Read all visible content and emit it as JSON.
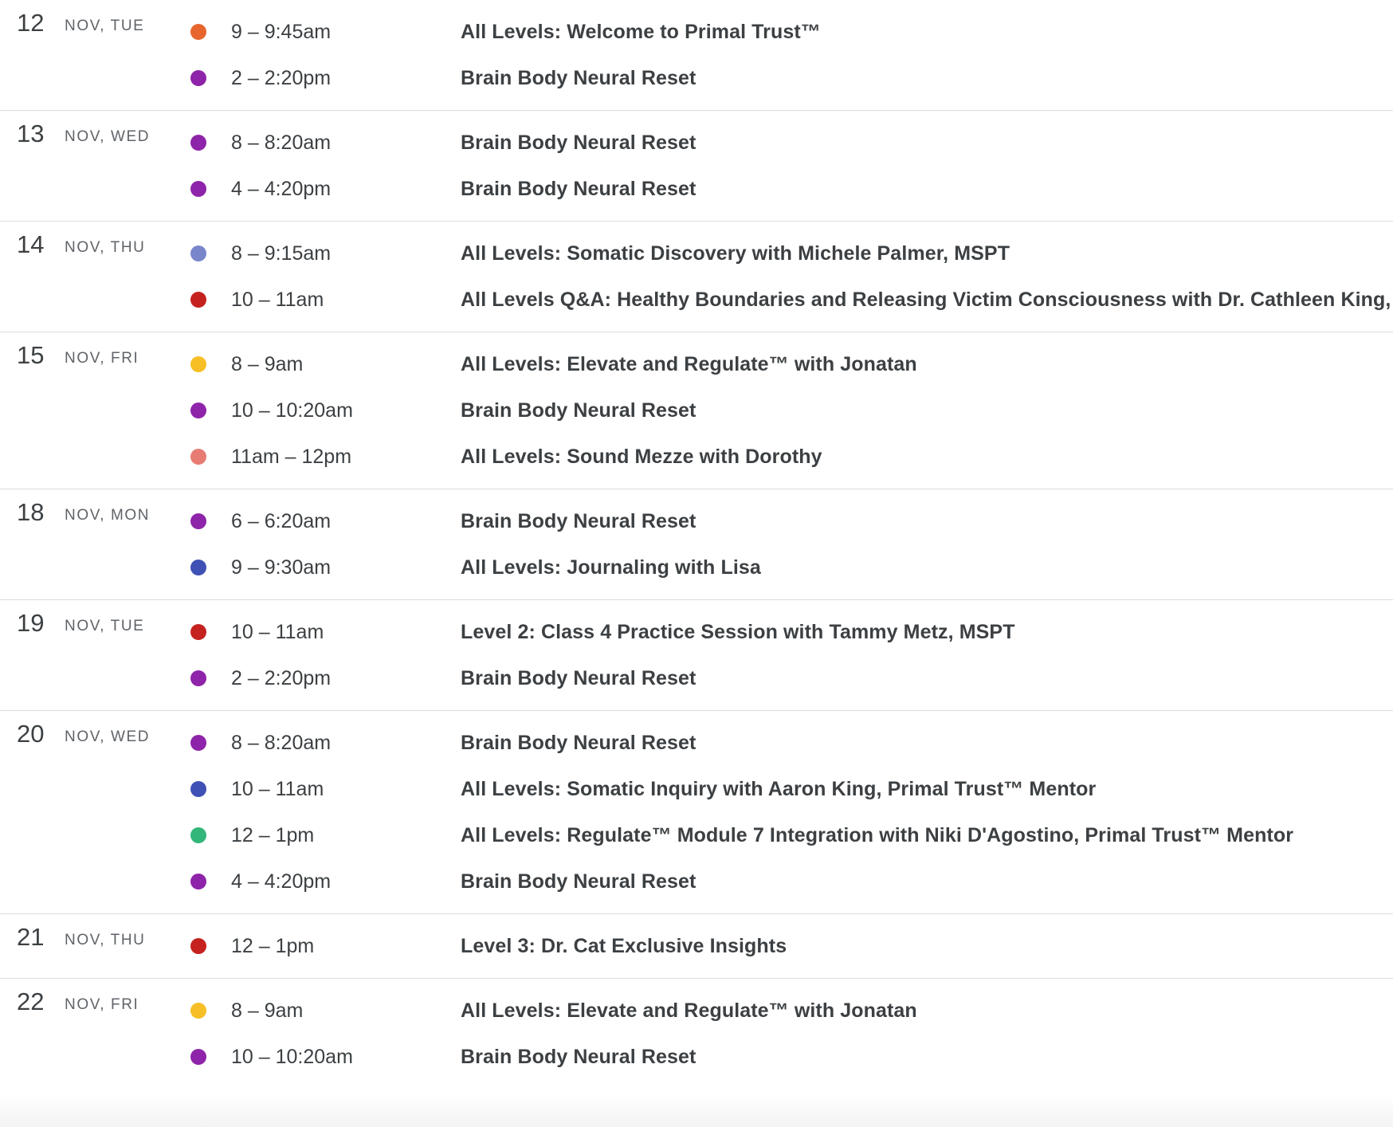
{
  "colors": {
    "orange": "#e8652e",
    "purple": "#8e24aa",
    "lavender": "#7986cb",
    "tomato": "#d50000",
    "red": "#c5221f",
    "banana": "#f6bf26",
    "flamingo": "#e67c73",
    "blueberry": "#3f51b5",
    "sage": "#33b679"
  },
  "days": [
    {
      "num": "12",
      "sub": "NOV, TUE",
      "events": [
        {
          "time": "9 – 9:45am",
          "title": "All Levels: Welcome to Primal Trust™",
          "color": "#e8652e"
        },
        {
          "time": "2 – 2:20pm",
          "title": "Brain Body Neural Reset",
          "color": "#8e24aa"
        }
      ]
    },
    {
      "num": "13",
      "sub": "NOV, WED",
      "events": [
        {
          "time": "8 – 8:20am",
          "title": "Brain Body Neural Reset",
          "color": "#8e24aa"
        },
        {
          "time": "4 – 4:20pm",
          "title": "Brain Body Neural Reset",
          "color": "#8e24aa"
        }
      ]
    },
    {
      "num": "14",
      "sub": "NOV, THU",
      "events": [
        {
          "time": "8 – 9:15am",
          "title": "All Levels: Somatic Discovery with Michele Palmer, MSPT",
          "color": "#7986cb"
        },
        {
          "time": "10 – 11am",
          "title": "All Levels Q&A: Healthy Boundaries and Releasing Victim Consciousness with Dr. Cathleen King, DPT",
          "color": "#c5221f"
        }
      ]
    },
    {
      "num": "15",
      "sub": "NOV, FRI",
      "events": [
        {
          "time": "8 – 9am",
          "title": "All Levels: Elevate and Regulate™ with Jonatan",
          "color": "#f6bf26"
        },
        {
          "time": "10 – 10:20am",
          "title": "Brain Body Neural Reset",
          "color": "#8e24aa"
        },
        {
          "time": "11am – 12pm",
          "title": "All Levels: Sound Mezze with Dorothy",
          "color": "#e67c73"
        }
      ]
    },
    {
      "num": "18",
      "sub": "NOV, MON",
      "events": [
        {
          "time": "6 – 6:20am",
          "title": "Brain Body Neural Reset",
          "color": "#8e24aa"
        },
        {
          "time": "9 – 9:30am",
          "title": "All Levels: Journaling with Lisa",
          "color": "#3f51b5"
        }
      ]
    },
    {
      "num": "19",
      "sub": "NOV, TUE",
      "events": [
        {
          "time": "10 – 11am",
          "title": "Level 2: Class 4 Practice Session with Tammy Metz, MSPT",
          "color": "#c5221f"
        },
        {
          "time": "2 – 2:20pm",
          "title": "Brain Body Neural Reset",
          "color": "#8e24aa"
        }
      ]
    },
    {
      "num": "20",
      "sub": "NOV, WED",
      "events": [
        {
          "time": "8 – 8:20am",
          "title": "Brain Body Neural Reset",
          "color": "#8e24aa"
        },
        {
          "time": "10 – 11am",
          "title": "All Levels: Somatic Inquiry with Aaron King, Primal Trust™ Mentor",
          "color": "#3f51b5"
        },
        {
          "time": "12 – 1pm",
          "title": "All Levels: Regulate™ Module 7 Integration with Niki D'Agostino, Primal Trust™ Mentor",
          "color": "#33b679"
        },
        {
          "time": "4 – 4:20pm",
          "title": "Brain Body Neural Reset",
          "color": "#8e24aa"
        }
      ]
    },
    {
      "num": "21",
      "sub": "NOV, THU",
      "events": [
        {
          "time": "12 – 1pm",
          "title": "Level 3: Dr. Cat Exclusive Insights",
          "color": "#c5221f"
        }
      ]
    },
    {
      "num": "22",
      "sub": "NOV, FRI",
      "events": [
        {
          "time": "8 – 9am",
          "title": "All Levels: Elevate and Regulate™ with Jonatan",
          "color": "#f6bf26"
        },
        {
          "time": "10 – 10:20am",
          "title": "Brain Body Neural Reset",
          "color": "#8e24aa"
        }
      ]
    }
  ]
}
